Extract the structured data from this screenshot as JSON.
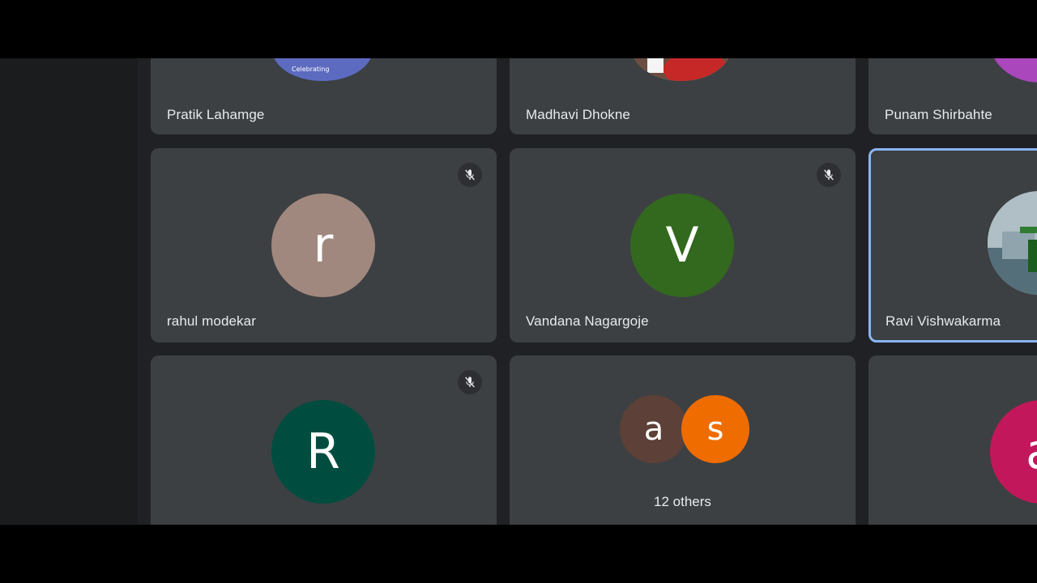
{
  "participants": {
    "row1": [
      {
        "name": "Pratik Lahamge"
      },
      {
        "name": "Madhavi Dhokne"
      },
      {
        "name": "Punam Shirbahte"
      }
    ],
    "row2": [
      {
        "name": "rahul modekar",
        "initial": "r",
        "color": "#a1887f"
      },
      {
        "name": "Vandana Nagargoje",
        "initial": "V",
        "color": "#33691e"
      },
      {
        "name": "Ravi Vishwakarma"
      }
    ],
    "row3": [
      {
        "initial": "R",
        "color": "#004d40"
      },
      {
        "others_label": "12 others",
        "stack": [
          {
            "initial": "a",
            "color": "#5d4037"
          },
          {
            "initial": "s",
            "color": "#ef6c00"
          }
        ]
      },
      {
        "initial": "a",
        "color": "#c2185b"
      }
    ]
  },
  "thumbnail_caption": "Celebrating",
  "icons": {
    "mute": "mic-off-icon"
  }
}
